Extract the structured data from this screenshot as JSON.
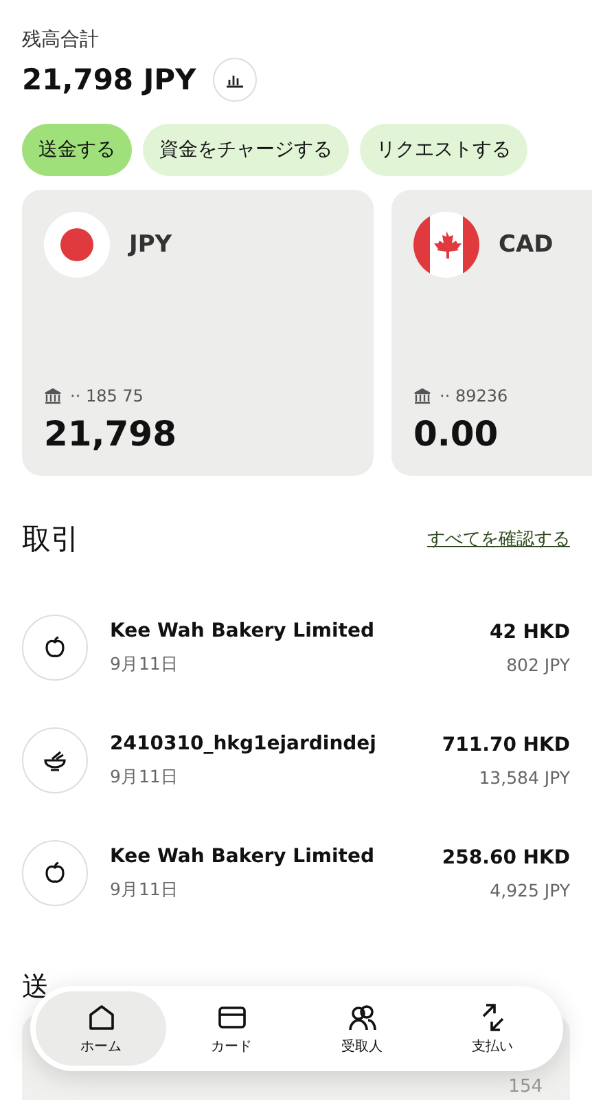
{
  "balance": {
    "label": "残高合計",
    "amount": "21,798 JPY"
  },
  "actions": [
    {
      "label": "送金する",
      "selected": true
    },
    {
      "label": "資金をチャージする",
      "selected": false
    },
    {
      "label": "リクエストする",
      "selected": false
    }
  ],
  "accounts": [
    {
      "currency": "JPY",
      "kind": "jp",
      "account": "·· 185 75",
      "amount": "21,798"
    },
    {
      "currency": "CAD",
      "kind": "ca",
      "account": "·· 89236",
      "amount": "0.00"
    }
  ],
  "transactions": {
    "title": "取引",
    "see_all": "すべてを確認する",
    "items": [
      {
        "kind": "apple",
        "name": "Kee Wah Bakery Limited",
        "date": "9月11日",
        "amount": "42 HKD",
        "converted": "802 JPY"
      },
      {
        "kind": "bowl",
        "name": "2410310_hkg1ejardindej",
        "date": "9月11日",
        "amount": "711.70 HKD",
        "converted": "13,584 JPY"
      },
      {
        "kind": "apple",
        "name": "Kee Wah Bakery Limited",
        "date": "9月11日",
        "amount": "258.60 HKD",
        "converted": "4,925 JPY"
      }
    ]
  },
  "calculator": {
    "title": "送",
    "value": "154"
  },
  "nav": [
    {
      "kind": "home",
      "label": "ホーム",
      "selected": true
    },
    {
      "kind": "card",
      "label": "カード",
      "selected": false
    },
    {
      "kind": "people",
      "label": "受取人",
      "selected": false
    },
    {
      "kind": "pay",
      "label": "支払い",
      "selected": false
    }
  ]
}
